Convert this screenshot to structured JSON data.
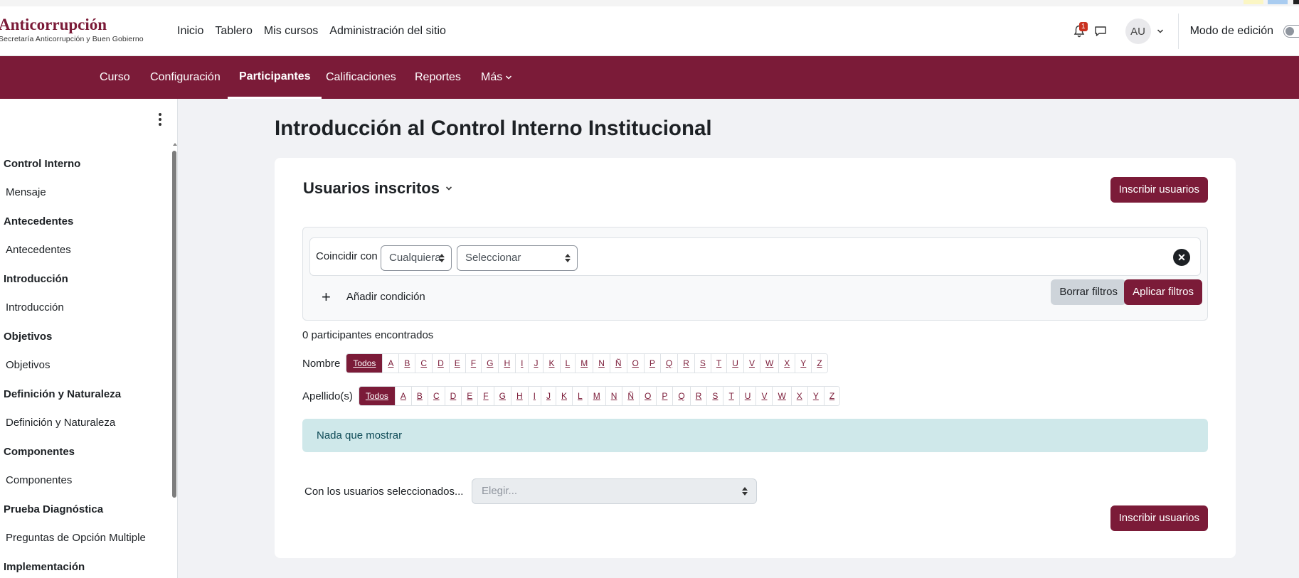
{
  "header": {
    "brand_title": "Anticorrupción",
    "brand_subtitle": "Secretaría Anticorrupción y Buen Gobierno",
    "primary_nav": [
      "Inicio",
      "Tablero",
      "Mis cursos",
      "Administración del sitio"
    ],
    "notification_count": "1",
    "user_initials": "AU",
    "edit_mode_label": "Modo de edición"
  },
  "secondary_nav": {
    "items": [
      "Curso",
      "Configuración",
      "Participantes",
      "Calificaciones",
      "Reportes",
      "Más"
    ],
    "active": "Participantes"
  },
  "course_index": [
    {
      "section": "Control Interno",
      "items": [
        "Mensaje"
      ]
    },
    {
      "section": "Antecedentes",
      "items": [
        "Antecedentes"
      ]
    },
    {
      "section": "Introducción",
      "items": [
        "Introducción"
      ]
    },
    {
      "section": "Objetivos",
      "items": [
        "Objetivos"
      ]
    },
    {
      "section": "Definición y Naturaleza",
      "items": [
        "Definición y Naturaleza"
      ]
    },
    {
      "section": "Componentes",
      "items": [
        "Componentes"
      ]
    },
    {
      "section": "Prueba Diagnóstica",
      "items": [
        "Preguntas de Opción Multiple"
      ]
    },
    {
      "section": "Implementación",
      "items": []
    }
  ],
  "page": {
    "title": "Introducción al Control Interno Institucional",
    "heading": "Usuarios inscritos",
    "enrol_button": "Inscribir usuarios"
  },
  "filters": {
    "match_label": "Coincidir con",
    "match_value": "Cualquiera",
    "type_value": "Seleccionar",
    "add_condition": "Añadir condición",
    "clear_button": "Borrar filtros",
    "apply_button": "Aplicar filtros"
  },
  "results": {
    "count_text": "0 participantes encontrados",
    "firstname_label": "Nombre",
    "lastname_label": "Apellido(s)",
    "all_label": "Todos",
    "letters": [
      "A",
      "B",
      "C",
      "D",
      "E",
      "F",
      "G",
      "H",
      "I",
      "J",
      "K",
      "L",
      "M",
      "N",
      "Ñ",
      "O",
      "P",
      "Q",
      "R",
      "S",
      "T",
      "U",
      "V",
      "W",
      "X",
      "Y",
      "Z"
    ],
    "empty_message": "Nada que mostrar"
  },
  "bulk": {
    "label": "Con los usuarios seleccionados...",
    "placeholder": "Elegir..."
  },
  "colors": {
    "brand": "#7b1b38",
    "alert_bg": "#cfe8ea"
  }
}
